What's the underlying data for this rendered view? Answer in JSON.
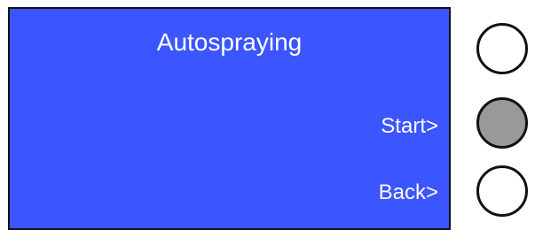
{
  "screen": {
    "title": "Autospraying",
    "background_color": "#3b55ff",
    "text_color": "#ffffff",
    "softkeys": [
      {
        "label": "Start>"
      },
      {
        "label": "Back>"
      }
    ]
  },
  "hardware_buttons": [
    {
      "position": "top",
      "state": "unpressed",
      "fill_color": "#ffffff"
    },
    {
      "position": "middle",
      "state": "pressed",
      "fill_color": "#999999"
    },
    {
      "position": "bottom",
      "state": "unpressed",
      "fill_color": "#ffffff"
    }
  ]
}
